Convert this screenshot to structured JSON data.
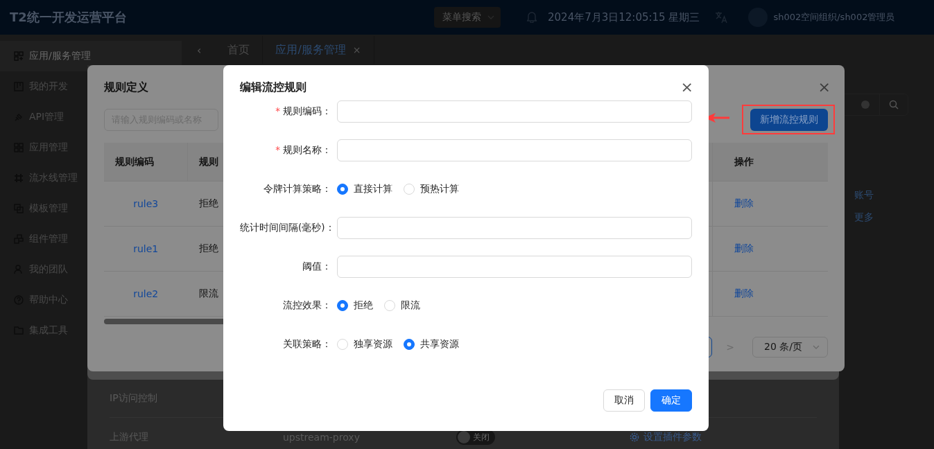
{
  "header": {
    "title": "T2统一开发运营平台",
    "menu_search": "菜单搜索",
    "datetime": "2024年7月3日12:05:15 星期三",
    "user": "sh002空间组织/sh002管理员"
  },
  "sidebar": {
    "items": [
      {
        "label": "应用/服务管理",
        "selected": true
      },
      {
        "label": "我的开发",
        "selected": false
      },
      {
        "label": "API管理",
        "selected": false
      },
      {
        "label": "应用管理",
        "selected": false
      },
      {
        "label": "流水线管理",
        "selected": false
      },
      {
        "label": "模板管理",
        "selected": false
      },
      {
        "label": "组件管理",
        "selected": false
      },
      {
        "label": "我的团队",
        "selected": false
      },
      {
        "label": "帮助中心",
        "selected": false
      },
      {
        "label": "集成工具",
        "selected": false
      }
    ]
  },
  "tab_strip": {
    "back": "‹",
    "close": "×",
    "tabs": [
      {
        "label": "首页",
        "selected": false,
        "closable": false
      },
      {
        "label": "应用/服务管理",
        "selected": true,
        "closable": true
      }
    ]
  },
  "side_links": [
    "账号",
    "更多"
  ],
  "plugin_panel": {
    "rows": [
      {
        "name": "IP访问控制"
      },
      {
        "name": "上游代理",
        "code": "upstream-proxy",
        "toggle": {
          "label": "关闭",
          "on": false
        },
        "action": "设置插件参数"
      }
    ]
  },
  "rule_dialog": {
    "title": "规则定义",
    "close": "×",
    "next": ">",
    "search_placeholder": "请输入规则编码或名称",
    "add_button": "新增流控规则",
    "columns": [
      "规则编码",
      "规则",
      "操作"
    ],
    "rows": [
      {
        "code": "rule3",
        "name": "拒绝",
        "action": "删除"
      },
      {
        "code": "rule1",
        "name": "拒绝",
        "action": "删除"
      },
      {
        "code": "rule2",
        "name": "限流",
        "action": "删除"
      }
    ],
    "page_size": "20 条/页"
  },
  "edit_dialog": {
    "title": "编辑流控规则",
    "close": "×",
    "required_mark": "*",
    "fields": [
      {
        "kind": "input",
        "label": "规则编码：",
        "required": true
      },
      {
        "kind": "input",
        "label": "规则名称：",
        "required": true
      },
      {
        "kind": "radio",
        "label": "令牌计算策略：",
        "required": false,
        "options": [
          {
            "label": "直接计算",
            "selected": true
          },
          {
            "label": "预热计算",
            "selected": false
          }
        ]
      },
      {
        "kind": "input",
        "label": "统计时间间隔(毫秒)：",
        "required": false
      },
      {
        "kind": "input",
        "label": "阈值：",
        "required": false
      },
      {
        "kind": "radio",
        "label": "流控效果：",
        "required": false,
        "options": [
          {
            "label": "拒绝",
            "selected": true
          },
          {
            "label": "限流",
            "selected": false
          }
        ]
      },
      {
        "kind": "radio",
        "label": "关联策略：",
        "required": false,
        "options": [
          {
            "label": "独享资源",
            "selected": false
          },
          {
            "label": "共享资源",
            "selected": true
          }
        ]
      }
    ],
    "buttons": [
      {
        "label": "取消",
        "primary": false
      },
      {
        "label": "确定",
        "primary": true
      }
    ]
  }
}
